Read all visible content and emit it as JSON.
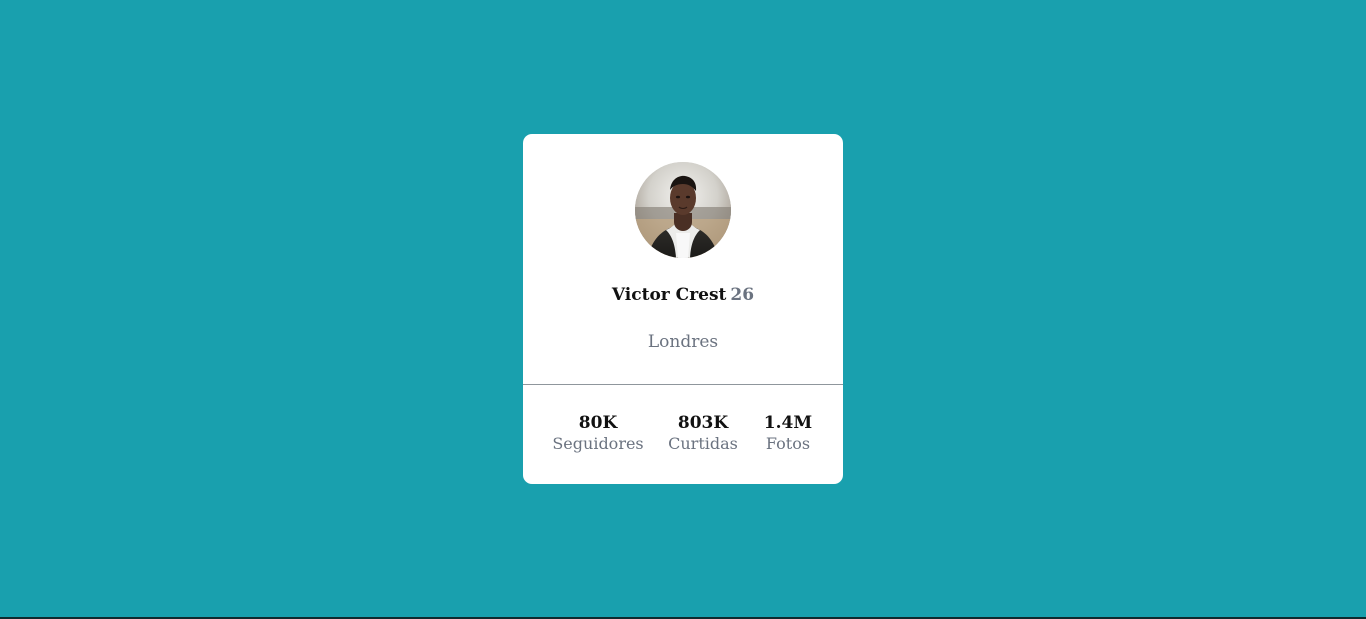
{
  "page": {
    "background_color": "#19a0ae"
  },
  "profile": {
    "name": "Victor Crest",
    "age": "26",
    "location": "Londres",
    "avatar_icon": "person-photo"
  },
  "stats": [
    {
      "value": "80K",
      "label": "Seguidores"
    },
    {
      "value": "803K",
      "label": "Curtidas"
    },
    {
      "value": "1.4M",
      "label": "Fotos"
    }
  ]
}
